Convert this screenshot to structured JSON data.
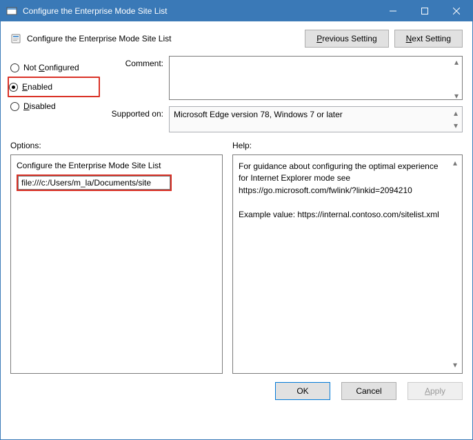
{
  "window": {
    "title": "Configure the Enterprise Mode Site List"
  },
  "header": {
    "title": "Configure the Enterprise Mode Site List",
    "prev_btn": "Previous Setting",
    "next_btn": "Next Setting"
  },
  "state": {
    "not_configured": "Not Configured",
    "enabled": "Enabled",
    "disabled": "Disabled",
    "selected": "enabled"
  },
  "info": {
    "comment_label": "Comment:",
    "comment_value": "",
    "supported_label": "Supported on:",
    "supported_value": "Microsoft Edge version 78, Windows 7 or later"
  },
  "sections": {
    "options_label": "Options:",
    "help_label": "Help:"
  },
  "options": {
    "field_label": "Configure the Enterprise Mode Site List",
    "field_value": "file:///c:/Users/m_la/Documents/site"
  },
  "help": {
    "line1": "For guidance about configuring the optimal experience for Internet Explorer mode see https://go.microsoft.com/fwlink/?linkid=2094210",
    "line2": "Example value: https://internal.contoso.com/sitelist.xml"
  },
  "footer": {
    "ok": "OK",
    "cancel": "Cancel",
    "apply": "Apply"
  }
}
